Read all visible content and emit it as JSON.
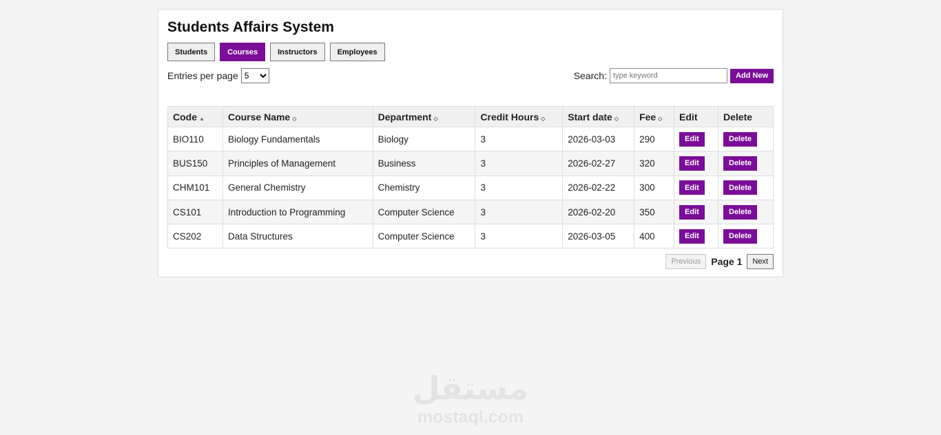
{
  "app": {
    "title": "Students Affairs System"
  },
  "tabs": [
    {
      "label": "Students",
      "active": false
    },
    {
      "label": "Courses",
      "active": true
    },
    {
      "label": "Instructors",
      "active": false
    },
    {
      "label": "Employees",
      "active": false
    }
  ],
  "controls": {
    "entries_label": "Entries per page",
    "entries_value": "5",
    "search_label": "Search:",
    "search_placeholder": "type keyword",
    "search_value": "",
    "add_new_label": "Add New"
  },
  "table": {
    "columns": [
      {
        "label": "Code",
        "sort_icon": "▲"
      },
      {
        "label": "Course Name",
        "sort_icon": "◇"
      },
      {
        "label": "Department",
        "sort_icon": "◇"
      },
      {
        "label": "Credit Hours",
        "sort_icon": "◇"
      },
      {
        "label": "Start date",
        "sort_icon": "◇"
      },
      {
        "label": "Fee",
        "sort_icon": "◇"
      },
      {
        "label": "Edit",
        "sort_icon": ""
      },
      {
        "label": "Delete",
        "sort_icon": ""
      }
    ],
    "edit_label": "Edit",
    "delete_label": "Delete",
    "rows": [
      {
        "code": "BIO110",
        "name": "Biology Fundamentals",
        "department": "Biology",
        "hours": "3",
        "start": "2026-03-03",
        "fee": "290"
      },
      {
        "code": "BUS150",
        "name": "Principles of Management",
        "department": "Business",
        "hours": "3",
        "start": "2026-02-27",
        "fee": "320"
      },
      {
        "code": "CHM101",
        "name": "General Chemistry",
        "department": "Chemistry",
        "hours": "3",
        "start": "2026-02-22",
        "fee": "300"
      },
      {
        "code": "CS101",
        "name": "Introduction to Programming",
        "department": "Computer Science",
        "hours": "3",
        "start": "2026-02-20",
        "fee": "350"
      },
      {
        "code": "CS202",
        "name": "Data Structures",
        "department": "Computer Science",
        "hours": "3",
        "start": "2026-03-05",
        "fee": "400"
      }
    ]
  },
  "pagination": {
    "previous_label": "Previous",
    "page_label": "Page 1",
    "next_label": "Next"
  },
  "watermark": {
    "arabic": "مستقل",
    "latin": "mostaql.com"
  },
  "colors": {
    "accent": "#7b0d99",
    "background": "#f4f4f4"
  }
}
